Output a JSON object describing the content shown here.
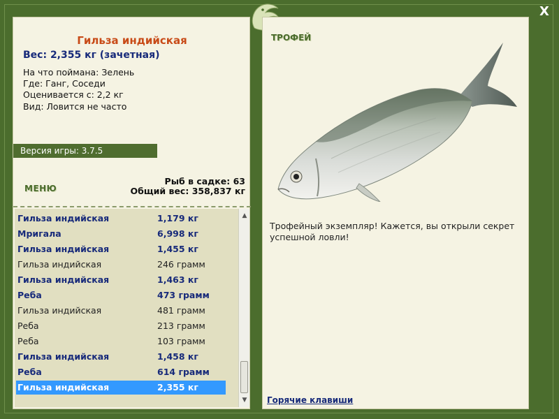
{
  "window": {
    "close_label": "X"
  },
  "fish": {
    "title": "Гильза индийская",
    "weight_line": "Вес: 2,355 кг (зачетная)",
    "details": [
      "На что поймана: Зелень",
      "Где: Ганг, Соседи",
      "Оценивается с: 2,2 кг",
      "Вид: Ловится не часто"
    ]
  },
  "game": {
    "version_label": "Версия игры: 3.7.5"
  },
  "menu": {
    "label": "МЕНЮ"
  },
  "keepnet": {
    "count_label": "Рыб в садке: 63",
    "total_label": "Общий вес: 358,837 кг"
  },
  "catches": [
    {
      "name": "Гильза индийская",
      "weight": "1,179 кг",
      "trophy": true
    },
    {
      "name": "Мригала",
      "weight": "6,998 кг",
      "trophy": true
    },
    {
      "name": "Гильза индийская",
      "weight": "1,455 кг",
      "trophy": true
    },
    {
      "name": "Гильза индийская",
      "weight": "246 грамм",
      "trophy": false
    },
    {
      "name": "Гильза индийская",
      "weight": "1,463 кг",
      "trophy": true
    },
    {
      "name": "Реба",
      "weight": "473 грамм",
      "trophy": true
    },
    {
      "name": "Гильза индийская",
      "weight": "481 грамм",
      "trophy": false
    },
    {
      "name": "Реба",
      "weight": "213 грамм",
      "trophy": false
    },
    {
      "name": "Реба",
      "weight": "103 грамм",
      "trophy": false
    },
    {
      "name": "Гильза индийская",
      "weight": "1,458 кг",
      "trophy": true
    },
    {
      "name": "Реба",
      "weight": "614 грамм",
      "trophy": true
    },
    {
      "name": "Гильза индийская",
      "weight": "2,355 кг",
      "trophy": true,
      "selected": true
    }
  ],
  "trophy": {
    "label": "ТРОФЕЙ",
    "description": "Трофейный экземпляр! Кажется, вы открыли секрет успешной ловли!"
  },
  "footer": {
    "hotkeys_label": "Горячие клавиши"
  },
  "colors": {
    "frame": "#4b6d2d",
    "panel": "#f5f3e3",
    "title": "#c84b18",
    "trophy_text": "#172a7a",
    "selection": "#3399ff"
  },
  "icons": {
    "emblem": "fish-emblem-icon",
    "close": "close-icon"
  }
}
